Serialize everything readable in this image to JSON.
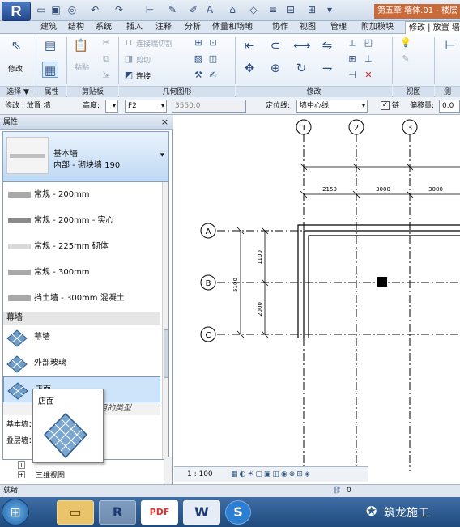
{
  "titlebar": {
    "app_button": "R",
    "doc_title": "第五章 墙体.01 - 楼层"
  },
  "ribbon_tabs": [
    "建筑",
    "结构",
    "系统",
    "插入",
    "注释",
    "分析",
    "体量和场地",
    "协作",
    "视图",
    "管理",
    "附加模块",
    "修改 | 放置 墙"
  ],
  "ribbon": {
    "modify_label": "修改",
    "paste_label": "粘贴",
    "join_cut": "连接端切割",
    "cut": "剪切",
    "join": "连接",
    "panels": [
      "选择 ▼",
      "属性",
      "剪贴板",
      "几何图形",
      "修改",
      "视图",
      "测"
    ]
  },
  "options_bar": {
    "context": "修改 | 放置 墙",
    "height_label": "高度:",
    "height_value": "F2",
    "height_num": "3550.0",
    "locline_label": "定位线:",
    "locline_value": "墙中心线",
    "chain_label": "链",
    "offset_label": "偏移量:",
    "offset_value": "0.0"
  },
  "properties": {
    "header": "属性",
    "close": "×",
    "type_family": "基本墙",
    "type_name": "内部 - 砌块墙 190"
  },
  "type_list": [
    {
      "label": "常规 - 200mm",
      "swatch": "#a9a9a9"
    },
    {
      "label": "常规 - 200mm - 实心",
      "swatch": "#8a8a8a"
    },
    {
      "label": "常规 - 225mm 砌体",
      "swatch": "#d8d8d8"
    },
    {
      "label": "常规 - 300mm",
      "swatch": "#a9a9a9"
    },
    {
      "label": "挡土墙 - 300mm 混凝土",
      "swatch": "#a9a9a9"
    }
  ],
  "curtain_group": "幕墙",
  "curtain_items": [
    "幕墙",
    "外部玻璃",
    "店面"
  ],
  "recent_label": "最近使用的类型",
  "recent_items": [
    "基本墙：内部 - 砌块墙 190",
    "叠层墙：外部 - 砌块勒脚砖墙"
  ],
  "tooltip": {
    "title": "店面"
  },
  "browser": {
    "item": "三维视图"
  },
  "drawing": {
    "grid_labels": [
      "1",
      "2",
      "3",
      "A",
      "B",
      "C"
    ],
    "dim_top": [
      "2150",
      "3000",
      "3000"
    ],
    "dim_left_total": "5100",
    "dim_left": [
      "1100",
      "2000"
    ]
  },
  "view_bar": {
    "scale": "1 : 100"
  },
  "status": {
    "text": "就绪",
    "value": "0"
  },
  "watermark": "筑龙施工",
  "taskbar": {
    "items": [
      "R",
      "PDF",
      "W",
      "S"
    ]
  }
}
